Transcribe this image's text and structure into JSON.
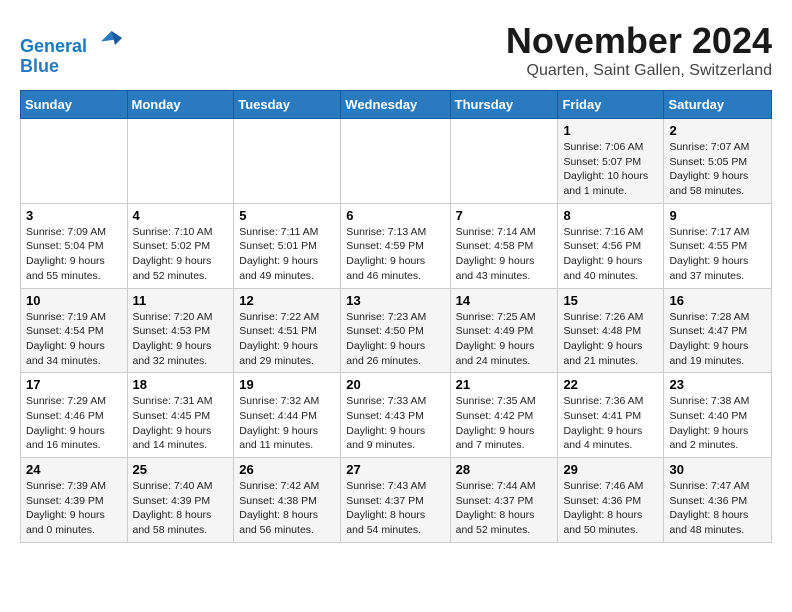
{
  "header": {
    "logo_line1": "General",
    "logo_line2": "Blue",
    "title": "November 2024",
    "location": "Quarten, Saint Gallen, Switzerland"
  },
  "days_of_week": [
    "Sunday",
    "Monday",
    "Tuesday",
    "Wednesday",
    "Thursday",
    "Friday",
    "Saturday"
  ],
  "weeks": [
    [
      {
        "day": "",
        "info": ""
      },
      {
        "day": "",
        "info": ""
      },
      {
        "day": "",
        "info": ""
      },
      {
        "day": "",
        "info": ""
      },
      {
        "day": "",
        "info": ""
      },
      {
        "day": "1",
        "info": "Sunrise: 7:06 AM\nSunset: 5:07 PM\nDaylight: 10 hours and 1 minute."
      },
      {
        "day": "2",
        "info": "Sunrise: 7:07 AM\nSunset: 5:05 PM\nDaylight: 9 hours and 58 minutes."
      }
    ],
    [
      {
        "day": "3",
        "info": "Sunrise: 7:09 AM\nSunset: 5:04 PM\nDaylight: 9 hours and 55 minutes."
      },
      {
        "day": "4",
        "info": "Sunrise: 7:10 AM\nSunset: 5:02 PM\nDaylight: 9 hours and 52 minutes."
      },
      {
        "day": "5",
        "info": "Sunrise: 7:11 AM\nSunset: 5:01 PM\nDaylight: 9 hours and 49 minutes."
      },
      {
        "day": "6",
        "info": "Sunrise: 7:13 AM\nSunset: 4:59 PM\nDaylight: 9 hours and 46 minutes."
      },
      {
        "day": "7",
        "info": "Sunrise: 7:14 AM\nSunset: 4:58 PM\nDaylight: 9 hours and 43 minutes."
      },
      {
        "day": "8",
        "info": "Sunrise: 7:16 AM\nSunset: 4:56 PM\nDaylight: 9 hours and 40 minutes."
      },
      {
        "day": "9",
        "info": "Sunrise: 7:17 AM\nSunset: 4:55 PM\nDaylight: 9 hours and 37 minutes."
      }
    ],
    [
      {
        "day": "10",
        "info": "Sunrise: 7:19 AM\nSunset: 4:54 PM\nDaylight: 9 hours and 34 minutes."
      },
      {
        "day": "11",
        "info": "Sunrise: 7:20 AM\nSunset: 4:53 PM\nDaylight: 9 hours and 32 minutes."
      },
      {
        "day": "12",
        "info": "Sunrise: 7:22 AM\nSunset: 4:51 PM\nDaylight: 9 hours and 29 minutes."
      },
      {
        "day": "13",
        "info": "Sunrise: 7:23 AM\nSunset: 4:50 PM\nDaylight: 9 hours and 26 minutes."
      },
      {
        "day": "14",
        "info": "Sunrise: 7:25 AM\nSunset: 4:49 PM\nDaylight: 9 hours and 24 minutes."
      },
      {
        "day": "15",
        "info": "Sunrise: 7:26 AM\nSunset: 4:48 PM\nDaylight: 9 hours and 21 minutes."
      },
      {
        "day": "16",
        "info": "Sunrise: 7:28 AM\nSunset: 4:47 PM\nDaylight: 9 hours and 19 minutes."
      }
    ],
    [
      {
        "day": "17",
        "info": "Sunrise: 7:29 AM\nSunset: 4:46 PM\nDaylight: 9 hours and 16 minutes."
      },
      {
        "day": "18",
        "info": "Sunrise: 7:31 AM\nSunset: 4:45 PM\nDaylight: 9 hours and 14 minutes."
      },
      {
        "day": "19",
        "info": "Sunrise: 7:32 AM\nSunset: 4:44 PM\nDaylight: 9 hours and 11 minutes."
      },
      {
        "day": "20",
        "info": "Sunrise: 7:33 AM\nSunset: 4:43 PM\nDaylight: 9 hours and 9 minutes."
      },
      {
        "day": "21",
        "info": "Sunrise: 7:35 AM\nSunset: 4:42 PM\nDaylight: 9 hours and 7 minutes."
      },
      {
        "day": "22",
        "info": "Sunrise: 7:36 AM\nSunset: 4:41 PM\nDaylight: 9 hours and 4 minutes."
      },
      {
        "day": "23",
        "info": "Sunrise: 7:38 AM\nSunset: 4:40 PM\nDaylight: 9 hours and 2 minutes."
      }
    ],
    [
      {
        "day": "24",
        "info": "Sunrise: 7:39 AM\nSunset: 4:39 PM\nDaylight: 9 hours and 0 minutes."
      },
      {
        "day": "25",
        "info": "Sunrise: 7:40 AM\nSunset: 4:39 PM\nDaylight: 8 hours and 58 minutes."
      },
      {
        "day": "26",
        "info": "Sunrise: 7:42 AM\nSunset: 4:38 PM\nDaylight: 8 hours and 56 minutes."
      },
      {
        "day": "27",
        "info": "Sunrise: 7:43 AM\nSunset: 4:37 PM\nDaylight: 8 hours and 54 minutes."
      },
      {
        "day": "28",
        "info": "Sunrise: 7:44 AM\nSunset: 4:37 PM\nDaylight: 8 hours and 52 minutes."
      },
      {
        "day": "29",
        "info": "Sunrise: 7:46 AM\nSunset: 4:36 PM\nDaylight: 8 hours and 50 minutes."
      },
      {
        "day": "30",
        "info": "Sunrise: 7:47 AM\nSunset: 4:36 PM\nDaylight: 8 hours and 48 minutes."
      }
    ]
  ]
}
